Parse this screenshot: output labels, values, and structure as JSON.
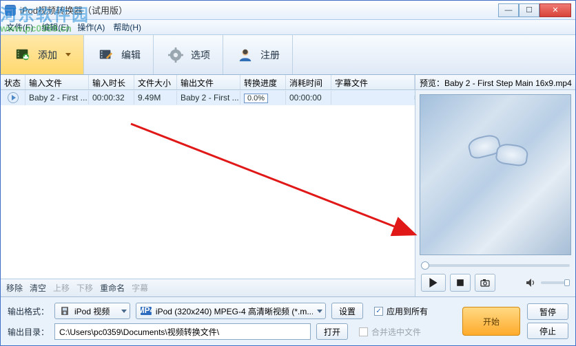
{
  "titlebar": {
    "title": "iPod视频转换器（试用版）"
  },
  "menubar": {
    "file": "文件(F)",
    "edit": "编辑(E)",
    "action": "操作(A)",
    "help": "帮助(H)"
  },
  "watermark": {
    "site": "河东软件园",
    "url": "www.pc0359.cn"
  },
  "toolbar": {
    "add": "添加",
    "edit": "编辑",
    "option": "选项",
    "register": "注册"
  },
  "grid": {
    "headers": {
      "status": "状态",
      "inputFile": "输入文件",
      "inputDur": "输入时长",
      "fileSize": "文件大小",
      "outputFile": "输出文件",
      "progress": "转换进度",
      "elapsed": "消耗时间",
      "subtitle": "字幕文件"
    },
    "rows": [
      {
        "inputFile": "Baby 2 - First ...",
        "inputDur": "00:00:32",
        "fileSize": "9.49M",
        "outputFile": "Baby 2 - First ...",
        "progress": "0.0%",
        "elapsed": "00:00:00",
        "subtitle": ""
      }
    ]
  },
  "listFooter": {
    "remove": "移除",
    "clear": "清空",
    "up": "上移",
    "down": "下移",
    "rename": "重命名",
    "subtitle": "字幕"
  },
  "preview": {
    "label": "预览：",
    "file": "Baby 2 - First Step Main 16x9.mp4"
  },
  "bottom": {
    "formatLabel": "输出格式：",
    "profileCombo": "iPod 视频",
    "codecCombo": "iPod (320x240) MPEG-4 高清晰视频 (*.m...",
    "settings": "设置",
    "applyAll": "应用到所有",
    "mergeSelected": "合并选中文件",
    "start": "开始",
    "pause": "暂停",
    "stop": "停止",
    "dirLabel": "输出目录：",
    "dirPath": "C:\\Users\\pc0359\\Documents\\视频转换文件\\",
    "open": "打开"
  },
  "colors": {
    "accent": "#ffb23a",
    "header": "#e4eef8",
    "rowSel": "#e4effd"
  }
}
